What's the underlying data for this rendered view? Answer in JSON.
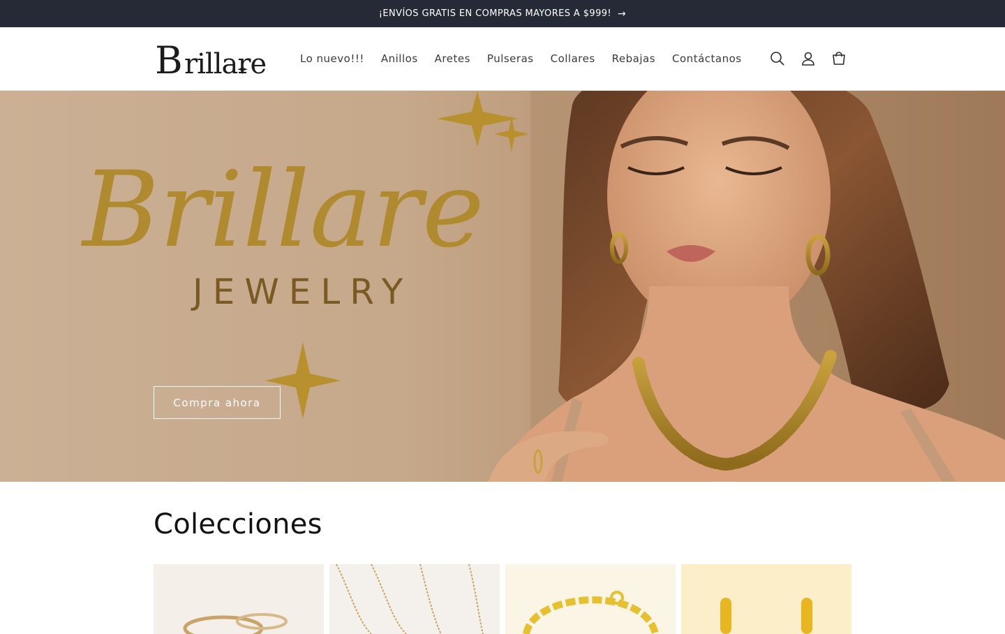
{
  "announcement": {
    "text": "¡ENVÍOS GRATIS EN COMPRAS MAYORES A $999!",
    "arrow": "→"
  },
  "header": {
    "logo_text": "Brillare",
    "nav": [
      {
        "label": "Lo nuevo!!!"
      },
      {
        "label": "Anillos"
      },
      {
        "label": "Aretes"
      },
      {
        "label": "Pulseras"
      },
      {
        "label": "Collares"
      },
      {
        "label": "Rebajas"
      },
      {
        "label": "Contáctanos"
      }
    ],
    "icons": [
      "search-icon",
      "account-icon",
      "cart-icon"
    ]
  },
  "hero": {
    "script_title": "Brillare",
    "subtitle": "JEWELRY",
    "cta_label": "Compra ahora"
  },
  "collections": {
    "title": "Colecciones",
    "cards": [
      "rings-collection",
      "necklaces-collection",
      "bracelets-collection",
      "earrings-collection"
    ]
  },
  "colors": {
    "announcement_bg": "#252a36",
    "gold": "#b08a2e",
    "hero_bg": "#c6a88a"
  }
}
